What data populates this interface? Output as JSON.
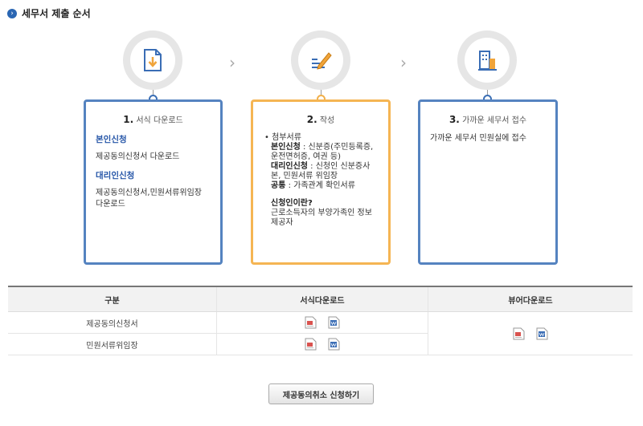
{
  "header": {
    "title": "세무서 제출 순서",
    "icon": "arrow-right-circle-icon"
  },
  "steps": [
    {
      "num": "1.",
      "title": "서식 다운로드",
      "sub1": "본인신청",
      "text1": "제공동의신청서 다운로드",
      "sub2": "대리인신청",
      "text2": "제공동의신청서,민원서류위임장 다운로드"
    },
    {
      "num": "2.",
      "title": "작성",
      "attach_label": "첨부서류",
      "self_label": "본인신청",
      "self_text": " : 신분증(주민등록증, 운전면허증, 여권 등)",
      "agent_label": "대리인신청",
      "agent_text": " : 신청인 신분증사본, 민원서류 위임장",
      "common_label": "공통",
      "common_text": " : 가족관계 확인서류",
      "question": "신청인이란?",
      "answer": "근로소득자의 부양가족인 정보 제공자"
    },
    {
      "num": "3.",
      "title": "가까운 세무서 접수",
      "text1": "가까운 세무서 민원실에 접수"
    }
  ],
  "table": {
    "headers": [
      "구분",
      "서식다운로드",
      "뷰어다운로드"
    ],
    "rows": [
      "제공동의신청서",
      "민원서류위임장"
    ]
  },
  "button": {
    "label": "제공동의취소 신청하기"
  },
  "colors": {
    "blue": "#5583c0",
    "orange": "#f5b553",
    "accent": "#2656a8"
  }
}
